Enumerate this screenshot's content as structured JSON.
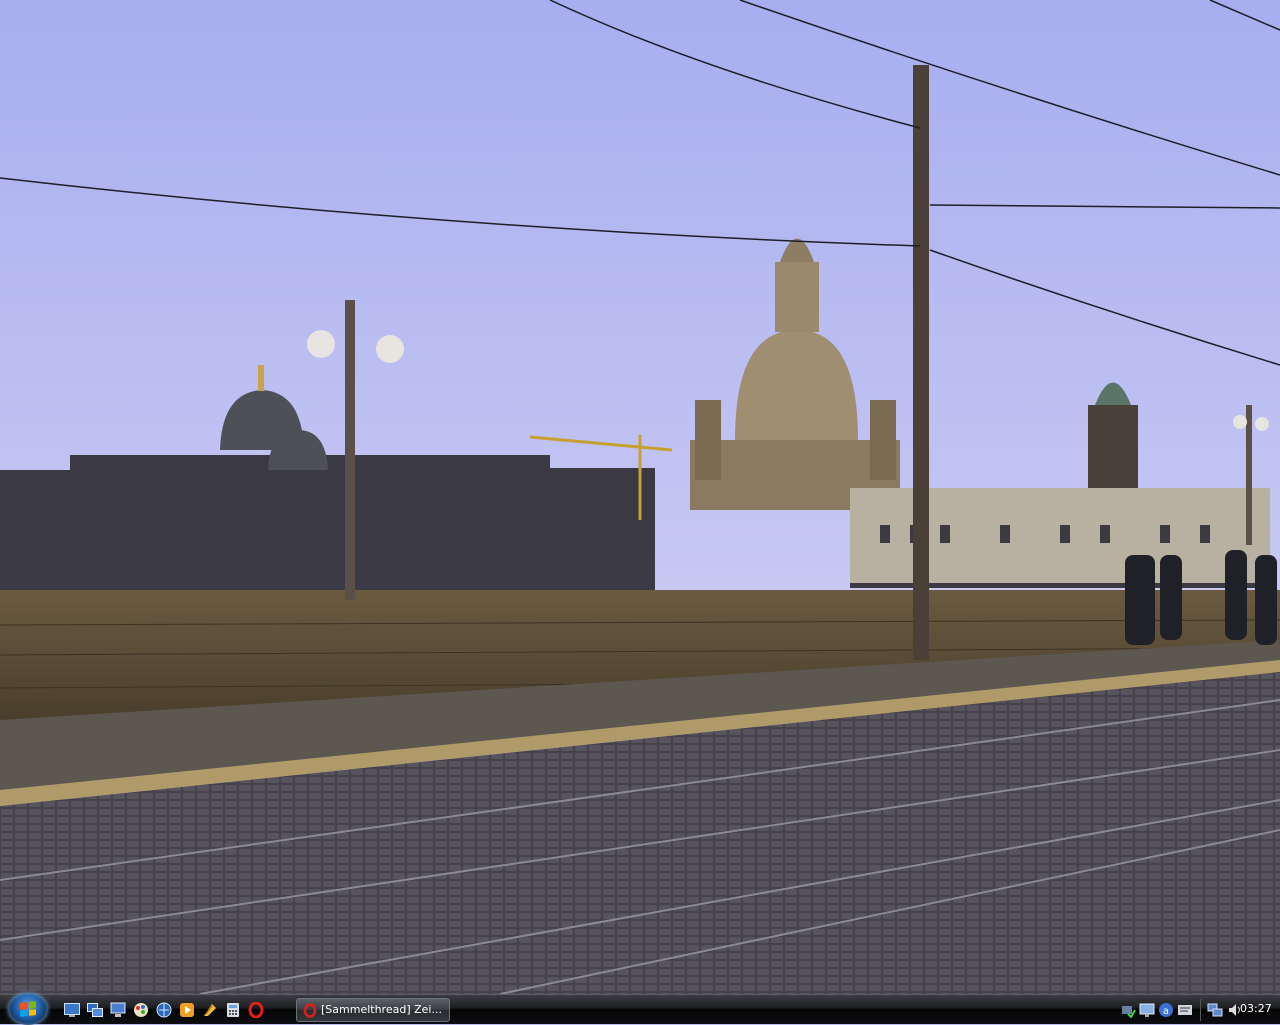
{
  "wallpaper": {
    "description_icon": "city-bridge-photo",
    "sky_top": "#a8b0f0",
    "sky_bottom": "#dcdcf6"
  },
  "taskbar": {
    "start_icon": "windows-orb-icon",
    "quick_launch": [
      {
        "name": "show-desktop-icon"
      },
      {
        "name": "switch-windows-icon"
      },
      {
        "name": "computer-icon"
      },
      {
        "name": "paint-icon"
      },
      {
        "name": "browser-globe-icon"
      },
      {
        "name": "media-player-icon"
      },
      {
        "name": "winamp-icon"
      },
      {
        "name": "calculator-icon"
      },
      {
        "name": "opera-icon"
      }
    ],
    "active_task": {
      "label": "[Sammelthread] Zei...",
      "icon": "opera-icon"
    },
    "tray": [
      {
        "name": "network-check-icon"
      },
      {
        "name": "display-icon"
      },
      {
        "name": "security-shield-icon"
      },
      {
        "name": "language-icon"
      },
      {
        "name": "network-icon"
      },
      {
        "name": "volume-icon"
      }
    ],
    "clock": "03:27"
  }
}
